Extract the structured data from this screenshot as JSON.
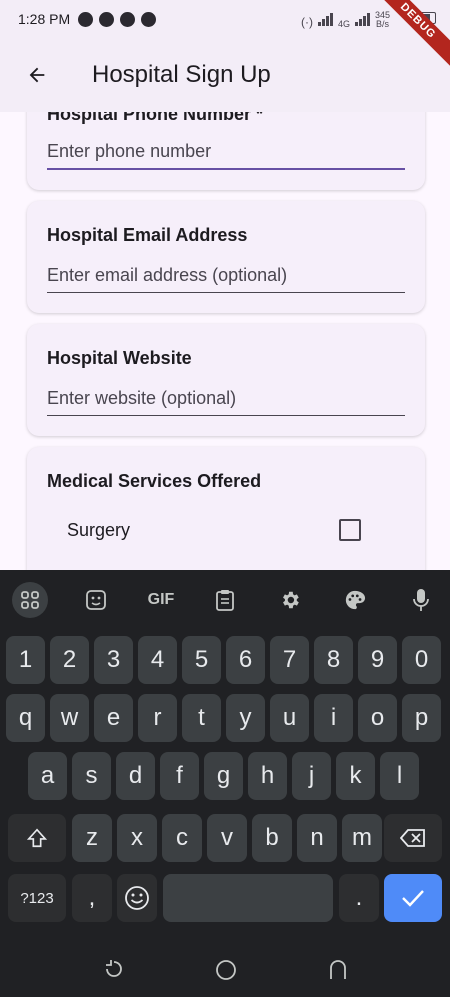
{
  "status_bar": {
    "time": "1:28 PM",
    "network_label": "4G",
    "speed_value": "345",
    "speed_unit": "B/s"
  },
  "debug_banner": "DEBUG",
  "app_bar": {
    "title": "Hospital Sign Up",
    "back_icon": "arrow-back-icon"
  },
  "form": {
    "phone": {
      "label": "Hospital Phone Number *",
      "placeholder": "Enter phone number"
    },
    "email": {
      "label": "Hospital Email Address",
      "placeholder": "Enter email address (optional)"
    },
    "website": {
      "label": "Hospital Website",
      "placeholder": "Enter website (optional)"
    },
    "services": {
      "label": "Medical Services Offered",
      "options": [
        {
          "label": "Surgery",
          "checked": false
        }
      ]
    }
  },
  "keyboard": {
    "toolbar": [
      "apps-grid-icon",
      "sticker-icon",
      "GIF",
      "clipboard-icon",
      "gear-icon",
      "palette-icon",
      "microphone-icon"
    ],
    "gif_label": "GIF",
    "row_numbers": [
      "1",
      "2",
      "3",
      "4",
      "5",
      "6",
      "7",
      "8",
      "9",
      "0"
    ],
    "row_1": [
      "q",
      "w",
      "e",
      "r",
      "t",
      "y",
      "u",
      "i",
      "o",
      "p"
    ],
    "row_2": [
      "a",
      "s",
      "d",
      "f",
      "g",
      "h",
      "j",
      "k",
      "l"
    ],
    "row_3": [
      "z",
      "x",
      "c",
      "v",
      "b",
      "n",
      "m"
    ],
    "symbols_key": "?123",
    "comma_key": ",",
    "period_key": "."
  },
  "colors": {
    "accent": "#6750a4",
    "enter_key": "#4f8bf8",
    "debug": "#b3261e"
  }
}
